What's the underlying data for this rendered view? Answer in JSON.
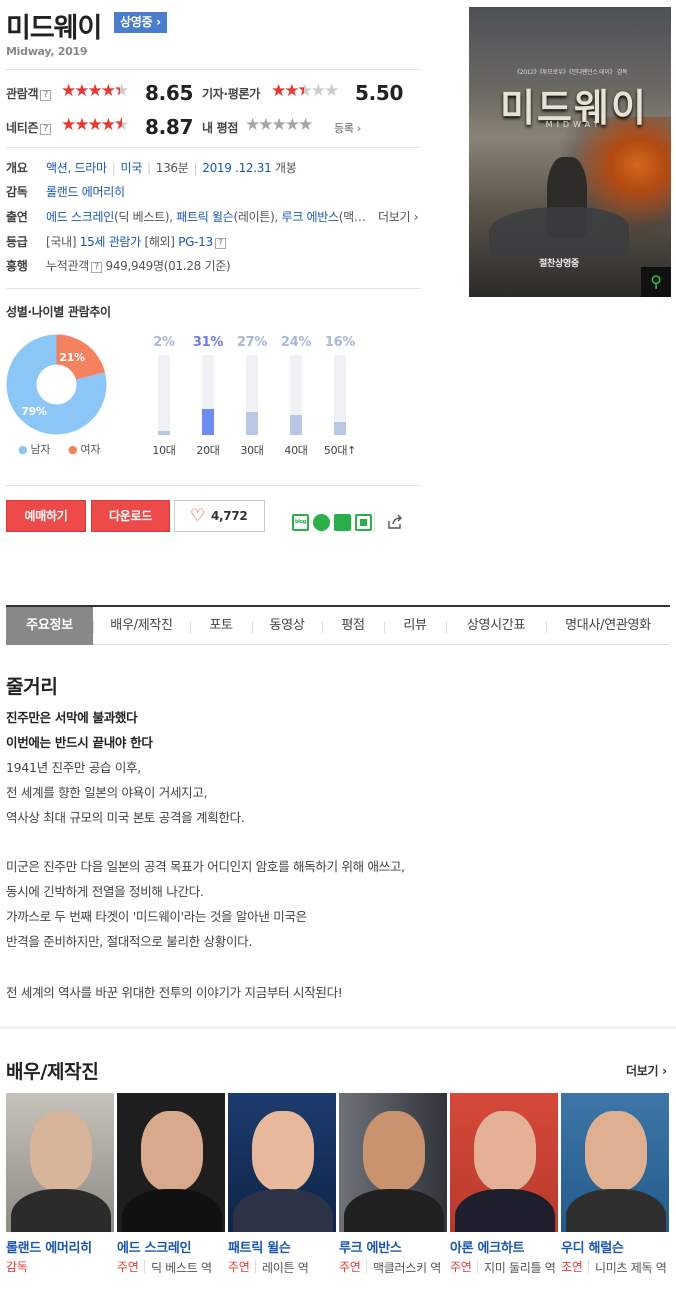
{
  "header": {
    "title": "미드웨이",
    "status": "상영중 ›",
    "subtitle": "Midway, 2019"
  },
  "ratings": {
    "audience": {
      "label": "관람객",
      "score": "8.65",
      "value": 8.65,
      "max": 10
    },
    "critic": {
      "label": "기자·평론가",
      "score": "5.50",
      "value": 5.5,
      "max": 10
    },
    "netizen": {
      "label": "네티즌",
      "score": "8.87",
      "value": 8.87,
      "max": 10
    },
    "my": {
      "label": "내 평점",
      "register": "등록 ›"
    },
    "help": "?"
  },
  "info": {
    "overview": {
      "label": "개요",
      "genres": [
        "액션",
        "드라마"
      ],
      "country": "미국",
      "runtime": "136분",
      "release_date": "2019 .12.31",
      "release_suffix": "개봉"
    },
    "director": {
      "label": "감독",
      "name": "롤랜드 에머리히"
    },
    "cast": {
      "label": "출연",
      "actors": [
        {
          "name": "에드 스크레인",
          "role": "(딕 베스트)"
        },
        {
          "name": "패트릭 윌슨",
          "role": "(레이튼)"
        },
        {
          "name": "루크 에반스",
          "role": "(맥…"
        }
      ],
      "more": "더보기 ›"
    },
    "rating": {
      "label": "등급",
      "domestic_prefix": "[국내]",
      "domestic": "15세 관람가",
      "overseas_prefix": "[해외]",
      "overseas": "PG-13"
    },
    "boxoffice": {
      "label": "흥행",
      "cumulative_label": "누적관객",
      "count": "949,949명",
      "basis": "(01.28 기준)"
    }
  },
  "poster": {
    "title": "미드웨이",
    "subtitle": "MIDWAY",
    "top_text": "《2012》《투모로우》《인디펜던스 데이》 감독",
    "bottom_text": "절찬상영중",
    "zoom_icon": "search-icon"
  },
  "trend": {
    "title": "성별·나이별 관람추이",
    "gender": {
      "male_pct": "79%",
      "female_pct": "21%",
      "male_value": 79,
      "female_value": 21,
      "male_label": "남자",
      "female_label": "여자",
      "male_color": "#8cc6f7",
      "female_color": "#f5825f"
    },
    "age": [
      {
        "label": "10대",
        "pct": "2%",
        "value": 2,
        "highlight": false
      },
      {
        "label": "20대",
        "pct": "31%",
        "value": 31,
        "highlight": true
      },
      {
        "label": "30대",
        "pct": "27%",
        "value": 27,
        "highlight": false
      },
      {
        "label": "40대",
        "pct": "24%",
        "value": 24,
        "highlight": false
      },
      {
        "label": "50대↑",
        "pct": "16%",
        "value": 16,
        "highlight": false
      }
    ]
  },
  "actions": {
    "reserve": "예매하기",
    "download": "다운로드",
    "likes": "4,772",
    "share_icons": [
      "blog-icon",
      "cafe-icon",
      "bookmark-icon",
      "memo-icon",
      "share-icon"
    ],
    "blog_text": "blog"
  },
  "tabs": [
    "주요정보",
    "배우/제작진",
    "포토",
    "동영상",
    "평점",
    "리뷰",
    "상영시간표",
    "명대사/연관영화"
  ],
  "synopsis": {
    "title": "줄거리",
    "headline1": "진주만은 서막에 불과했다",
    "headline2": "이번에는 반드시 끝내야 한다",
    "lines": [
      "1941년 진주만 공습 이후,",
      " 전 세계를 향한 일본의 야욕이 거세지고,",
      " 역사상 최대 규모의 미국 본토 공격을 계획한다.",
      "",
      " 미군은 진주만 다음 일본의 공격 목표가 어디인지 암호를 해독하기 위해 애쓰고,",
      " 동시에 긴박하게 전열을 정비해 나간다.",
      " 가까스로 두 번째 타겟이 '미드웨이'라는 것을 알아낸 미국은",
      " 반격을 준비하지만, 절대적으로 불리한 상황이다.",
      "",
      " 전 세계의 역사를 바꾼 위대한 전투의 이야기가 지금부터 시작된다!"
    ]
  },
  "cast_section": {
    "title": "배우/제작진",
    "more": "더보기 ›",
    "people": [
      {
        "name": "롤랜드 에머리히",
        "role": "감독",
        "character": ""
      },
      {
        "name": "에드 스크레인",
        "role": "주연",
        "character": "딕 베스트 역"
      },
      {
        "name": "패트릭 윌슨",
        "role": "주연",
        "character": "레이튼 역"
      },
      {
        "name": "루크 에반스",
        "role": "주연",
        "character": "맥클러스키 역"
      },
      {
        "name": "아론 에크하트",
        "role": "주연",
        "character": "지미 둘리틀 역"
      },
      {
        "name": "우디 해럴슨",
        "role": "조연",
        "character": "니미츠 제독 역"
      }
    ]
  }
}
